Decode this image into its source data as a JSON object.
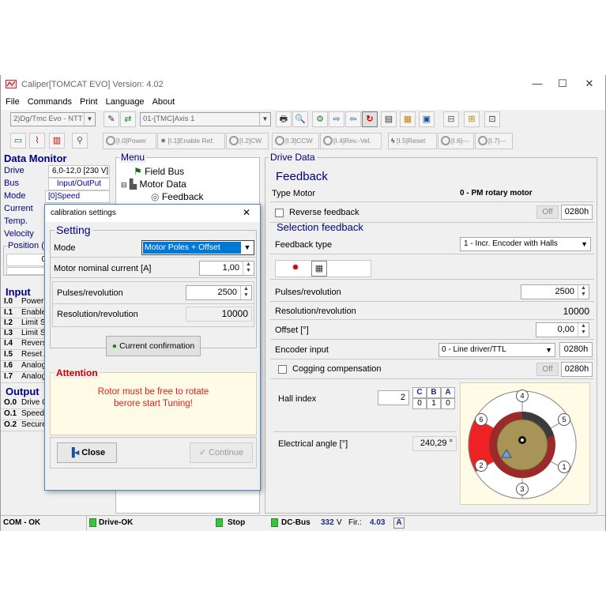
{
  "window": {
    "title": "Caliper[TOMCAT EVO] Version: 4.02",
    "controls": {
      "minimize": "—",
      "maximize": "☐",
      "close": "✕"
    }
  },
  "menu": [
    "File",
    "Commands",
    "Print",
    "Language",
    "About"
  ],
  "toolbar": {
    "device_combo": "2)Dg/Tmc Evo - NTT",
    "axis_combo": "01-[TMC]Axis 1",
    "function_buttons": [
      "[I.0]Power",
      "[I.1]Enable Ref.",
      "[I.2]CW",
      "[I.3]CCW",
      "[I.4]Rev.-Vel.",
      "[I.5]Reset",
      "[I.6]---",
      "[I.7]---"
    ]
  },
  "data_monitor": {
    "title": "Data Monitor",
    "rows": [
      {
        "label": "Drive",
        "value": "6,0-12,0 [230 V]"
      },
      {
        "label": "Bus",
        "value": "Input/OutPut"
      },
      {
        "label": "Mode",
        "value": "[0]Speed"
      },
      {
        "label": "Current",
        "value": ""
      },
      {
        "label": "Temp.",
        "value": ""
      },
      {
        "label": "Velocity",
        "value": ""
      }
    ],
    "position_label": "Position (",
    "position_value": "0"
  },
  "input": {
    "title": "Input",
    "rows": [
      {
        "id": "I.0",
        "label": "Power"
      },
      {
        "id": "I.1",
        "label": "Enable"
      },
      {
        "id": "I.2",
        "label": "Limit S"
      },
      {
        "id": "I.3",
        "label": "Limit S"
      },
      {
        "id": "I.4",
        "label": "Revers"
      },
      {
        "id": "I.5",
        "label": "Reset A"
      },
      {
        "id": "I.6",
        "label": "Analog"
      },
      {
        "id": "I.7",
        "label": "Analog"
      }
    ]
  },
  "output": {
    "title": "Output",
    "rows": [
      {
        "id": "O.0",
        "label": "Drive O"
      },
      {
        "id": "O.1",
        "label": "Speed"
      },
      {
        "id": "O.2",
        "label": "Secure"
      }
    ]
  },
  "menu_panel": {
    "title": "Menu",
    "tree": [
      "Field Bus",
      "Motor Data",
      "Feedback"
    ]
  },
  "drive_data": {
    "title": "Drive Data",
    "section": "Feedback",
    "type_motor_label": "Type Motor",
    "type_motor_value": "0 - PM rotary motor",
    "reverse_feedback_label": "Reverse feedback",
    "reverse_feedback_state": "Off",
    "reverse_feedback_hex": "0280h",
    "selection_title": "Selection feedback",
    "feedback_type_label": "Feedback type",
    "feedback_type_value": "1 - Incr. Encoder with Halls",
    "pulses_label": "Pulses/revolution",
    "pulses_value": "2500",
    "resolution_label": "Resolution/revolution",
    "resolution_value": "10000",
    "offset_label": "Offset [°]",
    "offset_value": "0,00",
    "encoder_input_label": "Encoder input",
    "encoder_input_value": "0 - Line driver/TTL",
    "encoder_input_hex": "0280h",
    "cogging_label": "Cogging compensation",
    "cogging_state": "Off",
    "cogging_hex": "0280h",
    "hall_index_label": "Hall index",
    "hall_index_value": "2",
    "hall_headers": [
      "C",
      "B",
      "A"
    ],
    "hall_bits": [
      "0",
      "1",
      "0"
    ],
    "electrical_angle_label": "Electrical angle [°]",
    "electrical_angle_value": "240,29 °",
    "sectors": [
      "1",
      "2",
      "3",
      "4",
      "5",
      "6"
    ],
    "active_sector": "2"
  },
  "dialog": {
    "title": "calibration settings",
    "close": "✕",
    "setting_title": "Setting",
    "mode_label": "Mode",
    "mode_value": "Motor Poles + Offset",
    "nominal_current_label": "Motor nominal current [A]",
    "nominal_current_value": "1,00",
    "pulses_label": "Pulses/revolution",
    "pulses_value": "2500",
    "resolution_label": "Resolution/revolution",
    "resolution_value": "10000",
    "confirm_button": "Current confirmation",
    "attention_title": "Attention",
    "attention_text_1": "Rotor must be free to rotate",
    "attention_text_2": "berore start Tuning!",
    "close_button": "Close",
    "continue_button": "Continue"
  },
  "status_bar": {
    "com": "COM - OK",
    "drive": "Drive-OK",
    "stop": "Stop",
    "dcbus_label": "DC-Bus",
    "dcbus_value": "332",
    "dcbus_unit": "V",
    "fir_label": "Fir.:",
    "fir_value": "4.03",
    "fir_mode": "A"
  },
  "colors": {
    "section_text": "#000080",
    "value_text": "#0000aa",
    "attention_title": "#cc0000",
    "attention_bg": "#fffbe6",
    "hall_active": "#ee2222",
    "motor_ring": "#9d2a2a",
    "motor_rotor": "#a89456",
    "dialog_border": "#4a88c8",
    "led_green": "#39c439"
  }
}
